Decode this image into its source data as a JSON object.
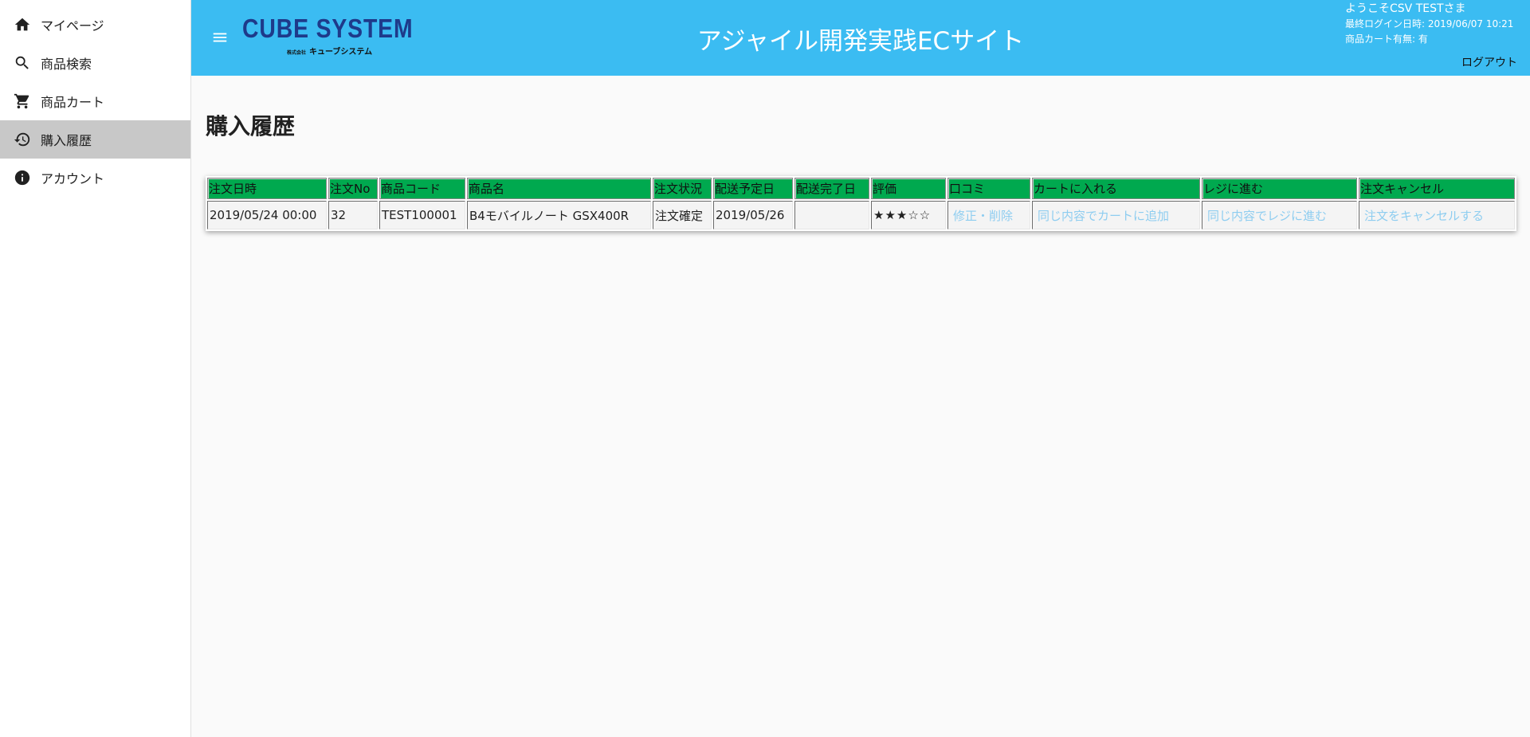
{
  "sidebar": {
    "items": [
      {
        "label": "マイページ",
        "icon": "home-icon",
        "active": false
      },
      {
        "label": "商品検索",
        "icon": "search-icon",
        "active": false
      },
      {
        "label": "商品カート",
        "icon": "cart-icon",
        "active": false
      },
      {
        "label": "購入履歴",
        "icon": "history-icon",
        "active": true
      },
      {
        "label": "アカウント",
        "icon": "info-icon",
        "active": false
      }
    ]
  },
  "header": {
    "logo_main": "CUBE SYSTEM",
    "logo_sub_small": "株式会社",
    "logo_sub": "キューブシステム",
    "title": "アジャイル開発実践ECサイト",
    "welcome": "ようこそCSV TESTさま",
    "last_login": "最終ログイン日時: 2019/06/07 10:21",
    "cart_status": "商品カート有無: 有",
    "logout": "ログアウト",
    "color": "#3bbcf2"
  },
  "main": {
    "page_title": "購入履歴",
    "table": {
      "headers": [
        "注文日時",
        "注文No",
        "商品コード",
        "商品名",
        "注文状況",
        "配送予定日",
        "配送完了日",
        "評価",
        "口コミ",
        "カートに入れる",
        "レジに進む",
        "注文キャンセル"
      ],
      "rows": [
        {
          "order_date": "2019/05/24 00:00",
          "order_no": "32",
          "product_code": "TEST100001",
          "product_name": "B4モバイルノート GSX400R",
          "status": "注文確定",
          "scheduled_delivery": "2019/05/26",
          "delivered_date": "",
          "rating": "★★★☆☆",
          "review_link": "修正・削除",
          "add_to_cart_link": "同じ内容でカートに追加",
          "checkout_link": "同じ内容でレジに進む",
          "cancel_link": "注文をキャンセルする"
        }
      ]
    },
    "header_color": "#00a94f",
    "link_color": "#8ecdf0"
  }
}
